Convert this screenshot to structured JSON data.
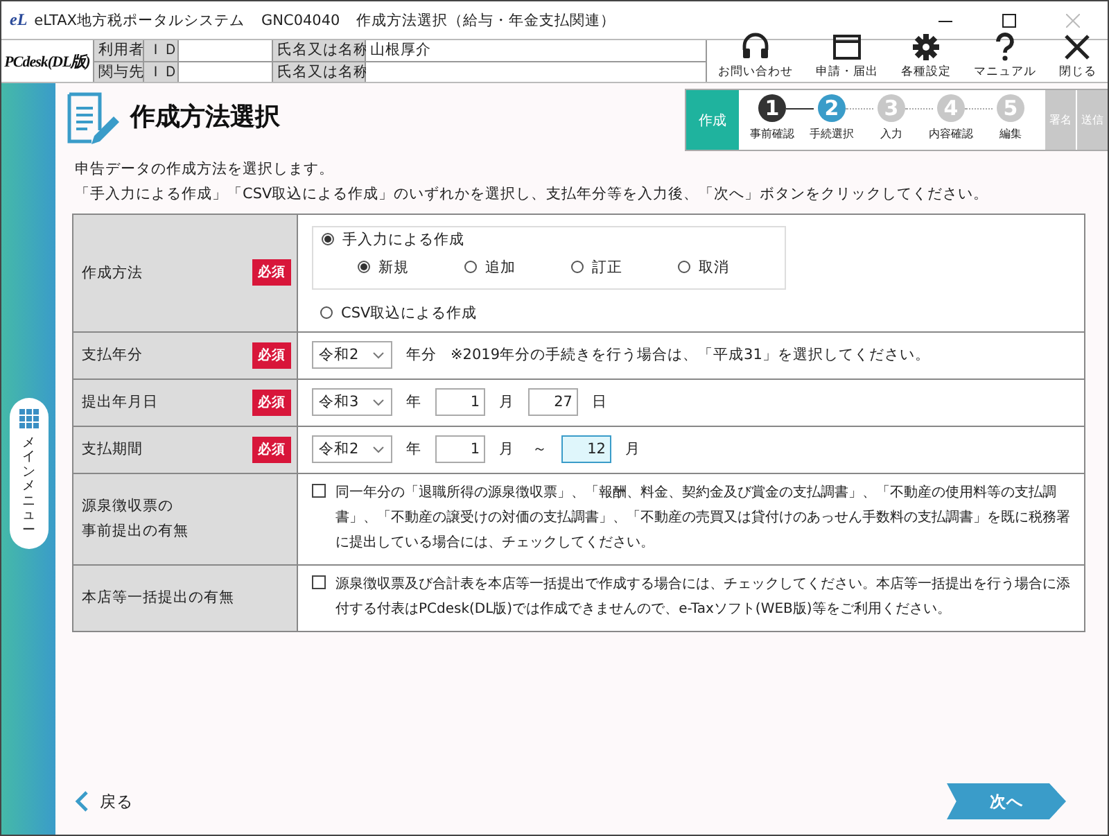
{
  "title_bar": {
    "logo": "eL",
    "app": "eLTAX地方税ポータルシステム",
    "code": "GNC04040",
    "screen": "作成方法選択（給与・年金支払関連）"
  },
  "header": {
    "logo": "PCdesk(DL版)",
    "info_rows": [
      {
        "role": "利用者",
        "id_label": "ＩＤ",
        "name_label": "氏名又は名称",
        "name": "山根厚介"
      },
      {
        "role": "関与先",
        "id_label": "ＩＤ",
        "name_label": "氏名又は名称"
      }
    ],
    "toolbar": [
      {
        "kind": "headset",
        "label": "お問い合わせ"
      },
      {
        "kind": "window",
        "label": "申請・届出"
      },
      {
        "kind": "gear",
        "label": "各種設定"
      },
      {
        "kind": "help",
        "label": "マニュアル"
      },
      {
        "kind": "close",
        "label": "閉じる"
      }
    ]
  },
  "sidebar": {
    "menu": "メインメニュー"
  },
  "page_title": "作成方法選択",
  "progress": {
    "phase": "作成",
    "steps": [
      {
        "number": "1",
        "label": "事前確認",
        "completed": true,
        "current": false
      },
      {
        "number": "2",
        "label": "手続選択",
        "completed": false,
        "current": true
      },
      {
        "number": "3",
        "label": "入力",
        "completed": false,
        "current": false
      },
      {
        "number": "4",
        "label": "内容確認",
        "completed": false,
        "current": false
      },
      {
        "number": "5",
        "label": "編集",
        "completed": false,
        "current": false
      }
    ],
    "later_phases": [
      "署名",
      "送信"
    ]
  },
  "description": [
    "申告データの作成方法を選択します。",
    "「手入力による作成」「CSV取込による作成」のいずれかを選択し、支払年分等を入力後、「次へ」ボタンをクリックしてください。"
  ],
  "form_rows": [
    {
      "kind": "method",
      "label": "作成方法",
      "badge": "必須",
      "options": [
        {
          "label": "手入力による作成",
          "selected": true,
          "children": [
            {
              "label": "新規",
              "selected": true
            },
            {
              "label": "追加",
              "selected": false
            },
            {
              "label": "訂正",
              "selected": false
            },
            {
              "label": "取消",
              "selected": false
            }
          ]
        },
        {
          "label": "CSV取込による作成",
          "selected": false
        }
      ]
    },
    {
      "kind": "fields",
      "label": "支払年分",
      "badge": "必須",
      "parts": [
        {
          "kind": "select",
          "value": "令和2"
        },
        {
          "kind": "unit",
          "text": "年分"
        },
        {
          "kind": "note",
          "text": "※2019年分の手続きを行う場合は、「平成31」を選択してください。"
        }
      ]
    },
    {
      "kind": "fields",
      "label": "提出年月日",
      "badge": "必須",
      "parts": [
        {
          "kind": "select",
          "value": "令和3"
        },
        {
          "kind": "unit",
          "text": "年"
        },
        {
          "kind": "input",
          "value": "1",
          "focused": false
        },
        {
          "kind": "unit",
          "text": "月"
        },
        {
          "kind": "input",
          "value": "27",
          "focused": false
        },
        {
          "kind": "unit",
          "text": "日"
        }
      ]
    },
    {
      "kind": "fields",
      "label": "支払期間",
      "badge": "必須",
      "parts": [
        {
          "kind": "select",
          "value": "令和2"
        },
        {
          "kind": "unit",
          "text": "年"
        },
        {
          "kind": "input",
          "value": "1",
          "focused": false
        },
        {
          "kind": "unit",
          "text": "月"
        },
        {
          "kind": "unit",
          "text": "～"
        },
        {
          "kind": "input",
          "value": "12",
          "focused": true
        },
        {
          "kind": "unit",
          "text": "月"
        }
      ]
    },
    {
      "kind": "checkbox",
      "label": "源泉徴収票の",
      "label_2": "事前提出の有無",
      "checked": false,
      "text": "同一年分の「退職所得の源泉徴収票」、「報酬、料金、契約金及び賞金の支払調書」、「不動産の使用料等の支払調書」、「不動産の譲受けの対価の支払調書」、「不動産の売買又は貸付けのあっせん手数料の支払調書」を既に税務署に提出している場合には、チェックしてください。"
    },
    {
      "kind": "checkbox",
      "label": "本店等一括提出の有無",
      "checked": false,
      "text": "源泉徴収票及び合計表を本店等一括提出で作成する場合には、チェックしてください。本店等一括提出を行う場合に添付する付表はPCdesk(DL版)では作成できませんので、e-Taxソフト(WEB版)等をご利用ください。"
    }
  ],
  "footer": {
    "back": "戻る",
    "next": "次へ"
  }
}
